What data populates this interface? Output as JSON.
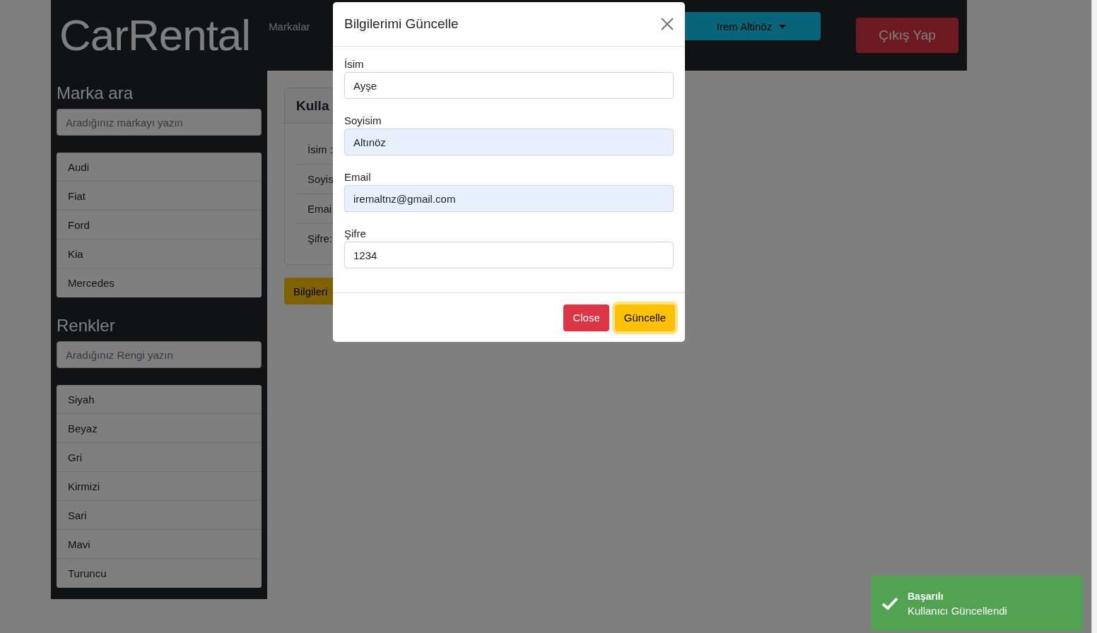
{
  "header": {
    "logo": "CarRental",
    "nav": [
      "Markalar"
    ],
    "user_menu": "Irem Altinöz",
    "logout": "Çıkış Yap"
  },
  "sidebar": {
    "brand_search": {
      "title": "Marka ara",
      "placeholder": "Aradığınız markayı yazın"
    },
    "brands": [
      "Audi",
      "Fiat",
      "Ford",
      "Kia",
      "Mercedes"
    ],
    "color_search": {
      "title": "Renkler",
      "placeholder": "Aradığınız Rengi yazın"
    },
    "colors": [
      "Siyah",
      "Beyaz",
      "Gri",
      "Kirmizi",
      "Sari",
      "Mavi",
      "Turuncu"
    ]
  },
  "user_card": {
    "title": "Kulla",
    "rows": [
      "İsim :",
      "Soyis",
      "Emai",
      "Şifre:"
    ],
    "button": "Bilgileri"
  },
  "modal": {
    "title": "Bilgilerimi Güncelle",
    "fields": [
      {
        "label": "İsim",
        "value": "Ayşe",
        "autofilled": false
      },
      {
        "label": "Soyisim",
        "value": "Altınöz",
        "autofilled": true
      },
      {
        "label": "Email",
        "value": "iremaltnz@gmail.com",
        "autofilled": true
      },
      {
        "label": "Şifre",
        "value": "1234",
        "autofilled": false
      }
    ],
    "buttons": [
      {
        "label": "Close",
        "kind": "danger",
        "focused": false
      },
      {
        "label": "Güncelle",
        "kind": "warning",
        "focused": true
      }
    ]
  },
  "toast": {
    "title": "Başarılı",
    "message": "Kullanıcı Güncellendi"
  }
}
